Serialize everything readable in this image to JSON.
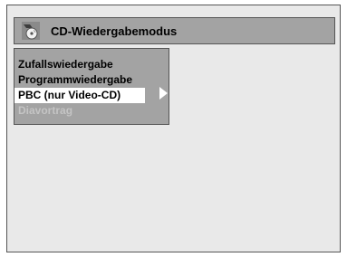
{
  "dialog": {
    "title": "CD-Wiedergabemodus",
    "title_icon": "disc-play-icon"
  },
  "menu": {
    "items": [
      {
        "label": "Zufallswiedergabe",
        "state": "normal"
      },
      {
        "label": "Programmwiedergabe",
        "state": "normal"
      },
      {
        "label": "PBC (nur Video-CD)",
        "state": "selected"
      },
      {
        "label": "Diavortrag",
        "state": "disabled"
      }
    ],
    "submenu_indicator": "arrow-right-icon"
  },
  "colors": {
    "background": "#e9e9e9",
    "panel": "#a3a3a3",
    "highlight": "#ffffff",
    "disabled_text": "#c4c4c4"
  }
}
